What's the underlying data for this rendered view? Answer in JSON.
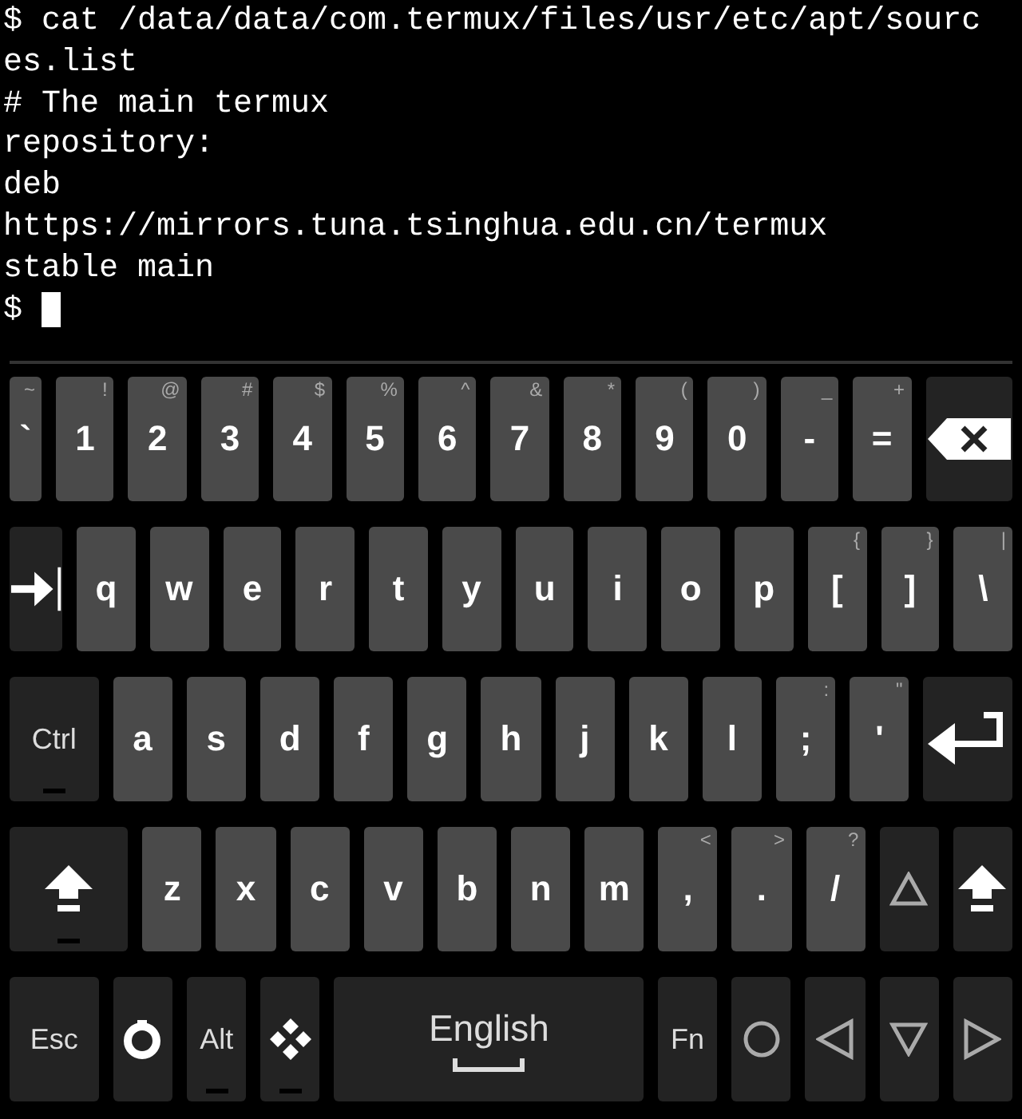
{
  "terminal": {
    "lines": [
      {
        "text": "$ cat /data/data/com.termux/files/usr/etc/apt/sourc",
        "cursor": false
      },
      {
        "text": "es.list",
        "cursor": false
      },
      {
        "text": "# The main termux",
        "cursor": false
      },
      {
        "text": "repository:",
        "cursor": false
      },
      {
        "text": "deb",
        "cursor": false
      },
      {
        "text": "https://mirrors.tuna.tsinghua.edu.cn/termux",
        "cursor": false
      },
      {
        "text": "stable main",
        "cursor": false
      },
      {
        "text": "$ ",
        "cursor": true
      }
    ]
  },
  "keyboard": {
    "rows": [
      {
        "keys": [
          {
            "kind": "char",
            "label": "`",
            "hint": "~"
          },
          {
            "kind": "char",
            "label": "1",
            "hint": "!"
          },
          {
            "kind": "char",
            "label": "2",
            "hint": "@"
          },
          {
            "kind": "char",
            "label": "3",
            "hint": "#"
          },
          {
            "kind": "char",
            "label": "4",
            "hint": "$"
          },
          {
            "kind": "char",
            "label": "5",
            "hint": "%"
          },
          {
            "kind": "char",
            "label": "6",
            "hint": "^"
          },
          {
            "kind": "char",
            "label": "7",
            "hint": "&"
          },
          {
            "kind": "char",
            "label": "8",
            "hint": "*"
          },
          {
            "kind": "char",
            "label": "9",
            "hint": "("
          },
          {
            "kind": "char",
            "label": "0",
            "hint": ")"
          },
          {
            "kind": "char",
            "label": "-",
            "hint": "_"
          },
          {
            "kind": "char",
            "label": "=",
            "hint": "+"
          },
          {
            "kind": "backspace"
          }
        ]
      },
      {
        "keys": [
          {
            "kind": "tab"
          },
          {
            "kind": "char",
            "label": "q"
          },
          {
            "kind": "char",
            "label": "w"
          },
          {
            "kind": "char",
            "label": "e"
          },
          {
            "kind": "char",
            "label": "r"
          },
          {
            "kind": "char",
            "label": "t"
          },
          {
            "kind": "char",
            "label": "y"
          },
          {
            "kind": "char",
            "label": "u"
          },
          {
            "kind": "char",
            "label": "i"
          },
          {
            "kind": "char",
            "label": "o"
          },
          {
            "kind": "char",
            "label": "p"
          },
          {
            "kind": "char",
            "label": "[",
            "hint": "{"
          },
          {
            "kind": "char",
            "label": "]",
            "hint": "}"
          },
          {
            "kind": "char",
            "label": "\\",
            "hint": "|"
          }
        ]
      },
      {
        "keys": [
          {
            "kind": "mod",
            "label": "Ctrl",
            "indicator": true
          },
          {
            "kind": "char",
            "label": "a"
          },
          {
            "kind": "char",
            "label": "s"
          },
          {
            "kind": "char",
            "label": "d"
          },
          {
            "kind": "char",
            "label": "f"
          },
          {
            "kind": "char",
            "label": "g"
          },
          {
            "kind": "char",
            "label": "h"
          },
          {
            "kind": "char",
            "label": "j"
          },
          {
            "kind": "char",
            "label": "k"
          },
          {
            "kind": "char",
            "label": "l"
          },
          {
            "kind": "char",
            "label": ";",
            "hint": ":"
          },
          {
            "kind": "char",
            "label": "'",
            "hint": "\""
          },
          {
            "kind": "enter"
          }
        ]
      },
      {
        "keys": [
          {
            "kind": "shift",
            "indicator": true
          },
          {
            "kind": "char",
            "label": "z"
          },
          {
            "kind": "char",
            "label": "x"
          },
          {
            "kind": "char",
            "label": "c"
          },
          {
            "kind": "char",
            "label": "v"
          },
          {
            "kind": "char",
            "label": "b"
          },
          {
            "kind": "char",
            "label": "n"
          },
          {
            "kind": "char",
            "label": "m"
          },
          {
            "kind": "char",
            "label": ",",
            "hint": "<"
          },
          {
            "kind": "char",
            "label": ".",
            "hint": ">"
          },
          {
            "kind": "char",
            "label": "/",
            "hint": "?"
          },
          {
            "kind": "up"
          },
          {
            "kind": "shift",
            "indicator": false
          }
        ]
      },
      {
        "keys": [
          {
            "kind": "mod",
            "label": "Esc",
            "indicator": false
          },
          {
            "kind": "gear"
          },
          {
            "kind": "mod",
            "label": "Alt",
            "indicator": true
          },
          {
            "kind": "dpad",
            "indicator": true
          },
          {
            "kind": "space",
            "label": "English"
          },
          {
            "kind": "mod",
            "label": "Fn",
            "indicator": false
          },
          {
            "kind": "circle"
          },
          {
            "kind": "left"
          },
          {
            "kind": "down"
          },
          {
            "kind": "right"
          }
        ]
      }
    ]
  }
}
